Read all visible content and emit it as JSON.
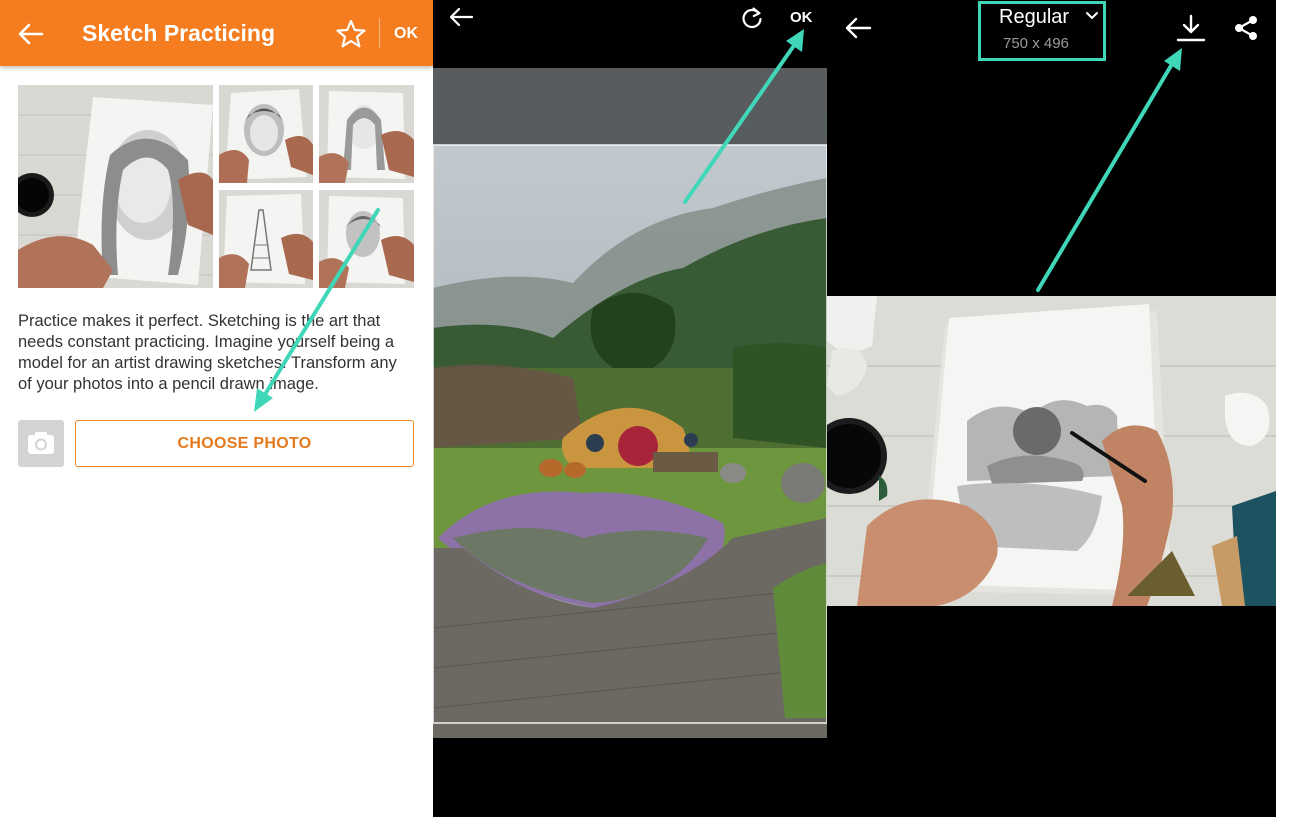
{
  "screen1": {
    "title": "Sketch Practicing",
    "ok_label": "OK",
    "description": "Practice makes it perfect. Sketching is the art that needs constant practicing. Imagine yourself being a model for an artist drawing sketches. Transform any of your photos into a pencil drawn image.",
    "choose_photo_label": "CHOOSE PHOTO",
    "icons": {
      "back": "back-arrow-icon",
      "favorite": "star-icon",
      "camera": "camera-icon"
    }
  },
  "screen2": {
    "ok_label": "OK",
    "icons": {
      "back": "back-arrow-icon",
      "rotate": "rotate-icon"
    }
  },
  "screen3": {
    "size_label": "Regular",
    "size_value": "750 x 496",
    "icons": {
      "back": "back-arrow-icon",
      "dropdown": "chevron-down-icon",
      "download": "download-icon",
      "share": "share-icon"
    }
  },
  "colors": {
    "appbar": "#f57c1f",
    "button_text": "#e47a1c",
    "annotation": "#40d6b8"
  }
}
